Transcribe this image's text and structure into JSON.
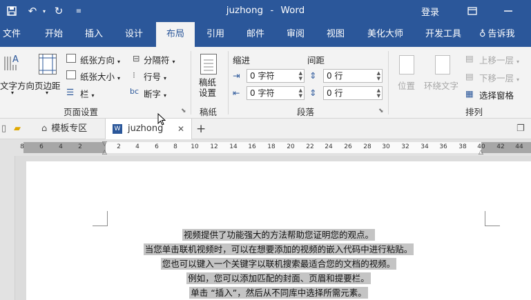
{
  "titlebar": {
    "doc_name": "juzhong",
    "separator": "-",
    "app_name": "Word",
    "login": "登录"
  },
  "tabs": [
    "文件",
    "开始",
    "插入",
    "设计",
    "布局",
    "引用",
    "邮件",
    "审阅",
    "视图",
    "美化大师",
    "开发工具",
    "告诉我"
  ],
  "active_tab": "布局",
  "ribbon": {
    "page_setup": {
      "text_direction": "文字方向",
      "margins": "页边距",
      "orientation": "纸张方向",
      "size": "纸张大小",
      "columns": "栏",
      "breaks": "分隔符",
      "line_numbers": "行号",
      "hyphenation": "断字",
      "group_label": "页面设置"
    },
    "manuscript": {
      "button": "稿纸设置",
      "group_label": "稿纸"
    },
    "paragraph": {
      "indent_header": "缩进",
      "spacing_header": "间距",
      "indent_left": "0 字符",
      "indent_right": "0 字符",
      "spacing_before": "0 行",
      "spacing_after": "0 行",
      "group_label": "段落"
    },
    "arrange": {
      "position": "位置",
      "wrap_text": "环绕文字",
      "bring_forward": "上移一层",
      "send_backward": "下移一层",
      "selection_pane": "选择窗格",
      "group_label": "排列"
    }
  },
  "doc_tabs": {
    "template_zone": "模板专区",
    "document": "juzhong",
    "close": "✕",
    "add": "+"
  },
  "ruler_ticks": [
    "8",
    "6",
    "4",
    "2",
    "2",
    "4",
    "6",
    "8",
    "10",
    "12",
    "14",
    "16",
    "18",
    "20",
    "22",
    "24",
    "26",
    "28",
    "30",
    "32",
    "34",
    "36",
    "38",
    "40",
    "42",
    "44"
  ],
  "document_lines": [
    "视频提供了功能强大的方法帮助您证明您的观点。",
    "当您单击联机视频时，可以在想要添加的视频的嵌入代码中进行粘贴。",
    "您也可以键入一个关键字以联机搜索最适合您的文档的视频。",
    "例如，您可以添加匹配的封面、页眉和提要栏。",
    "单击 “插入”，然后从不同库中选择所需元素。"
  ]
}
